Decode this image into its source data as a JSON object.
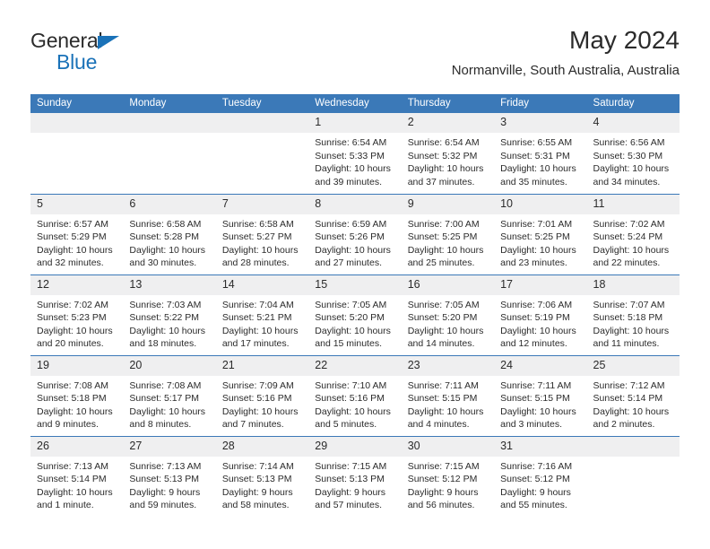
{
  "brand": {
    "name_top": "General",
    "name_bottom": "Blue",
    "accent_color": "#1a72b8"
  },
  "header": {
    "title": "May 2024",
    "subtitle": "Normanville, South Australia, Australia"
  },
  "calendar": {
    "header_bg": "#3b79b8",
    "daynum_bg": "#efeff0",
    "weekday_headers": [
      "Sunday",
      "Monday",
      "Tuesday",
      "Wednesday",
      "Thursday",
      "Friday",
      "Saturday"
    ],
    "weeks": [
      [
        {
          "day": "",
          "lines": []
        },
        {
          "day": "",
          "lines": []
        },
        {
          "day": "",
          "lines": []
        },
        {
          "day": "1",
          "lines": [
            "Sunrise: 6:54 AM",
            "Sunset: 5:33 PM",
            "Daylight: 10 hours",
            "and 39 minutes."
          ]
        },
        {
          "day": "2",
          "lines": [
            "Sunrise: 6:54 AM",
            "Sunset: 5:32 PM",
            "Daylight: 10 hours",
            "and 37 minutes."
          ]
        },
        {
          "day": "3",
          "lines": [
            "Sunrise: 6:55 AM",
            "Sunset: 5:31 PM",
            "Daylight: 10 hours",
            "and 35 minutes."
          ]
        },
        {
          "day": "4",
          "lines": [
            "Sunrise: 6:56 AM",
            "Sunset: 5:30 PM",
            "Daylight: 10 hours",
            "and 34 minutes."
          ]
        }
      ],
      [
        {
          "day": "5",
          "lines": [
            "Sunrise: 6:57 AM",
            "Sunset: 5:29 PM",
            "Daylight: 10 hours",
            "and 32 minutes."
          ]
        },
        {
          "day": "6",
          "lines": [
            "Sunrise: 6:58 AM",
            "Sunset: 5:28 PM",
            "Daylight: 10 hours",
            "and 30 minutes."
          ]
        },
        {
          "day": "7",
          "lines": [
            "Sunrise: 6:58 AM",
            "Sunset: 5:27 PM",
            "Daylight: 10 hours",
            "and 28 minutes."
          ]
        },
        {
          "day": "8",
          "lines": [
            "Sunrise: 6:59 AM",
            "Sunset: 5:26 PM",
            "Daylight: 10 hours",
            "and 27 minutes."
          ]
        },
        {
          "day": "9",
          "lines": [
            "Sunrise: 7:00 AM",
            "Sunset: 5:25 PM",
            "Daylight: 10 hours",
            "and 25 minutes."
          ]
        },
        {
          "day": "10",
          "lines": [
            "Sunrise: 7:01 AM",
            "Sunset: 5:25 PM",
            "Daylight: 10 hours",
            "and 23 minutes."
          ]
        },
        {
          "day": "11",
          "lines": [
            "Sunrise: 7:02 AM",
            "Sunset: 5:24 PM",
            "Daylight: 10 hours",
            "and 22 minutes."
          ]
        }
      ],
      [
        {
          "day": "12",
          "lines": [
            "Sunrise: 7:02 AM",
            "Sunset: 5:23 PM",
            "Daylight: 10 hours",
            "and 20 minutes."
          ]
        },
        {
          "day": "13",
          "lines": [
            "Sunrise: 7:03 AM",
            "Sunset: 5:22 PM",
            "Daylight: 10 hours",
            "and 18 minutes."
          ]
        },
        {
          "day": "14",
          "lines": [
            "Sunrise: 7:04 AM",
            "Sunset: 5:21 PM",
            "Daylight: 10 hours",
            "and 17 minutes."
          ]
        },
        {
          "day": "15",
          "lines": [
            "Sunrise: 7:05 AM",
            "Sunset: 5:20 PM",
            "Daylight: 10 hours",
            "and 15 minutes."
          ]
        },
        {
          "day": "16",
          "lines": [
            "Sunrise: 7:05 AM",
            "Sunset: 5:20 PM",
            "Daylight: 10 hours",
            "and 14 minutes."
          ]
        },
        {
          "day": "17",
          "lines": [
            "Sunrise: 7:06 AM",
            "Sunset: 5:19 PM",
            "Daylight: 10 hours",
            "and 12 minutes."
          ]
        },
        {
          "day": "18",
          "lines": [
            "Sunrise: 7:07 AM",
            "Sunset: 5:18 PM",
            "Daylight: 10 hours",
            "and 11 minutes."
          ]
        }
      ],
      [
        {
          "day": "19",
          "lines": [
            "Sunrise: 7:08 AM",
            "Sunset: 5:18 PM",
            "Daylight: 10 hours",
            "and 9 minutes."
          ]
        },
        {
          "day": "20",
          "lines": [
            "Sunrise: 7:08 AM",
            "Sunset: 5:17 PM",
            "Daylight: 10 hours",
            "and 8 minutes."
          ]
        },
        {
          "day": "21",
          "lines": [
            "Sunrise: 7:09 AM",
            "Sunset: 5:16 PM",
            "Daylight: 10 hours",
            "and 7 minutes."
          ]
        },
        {
          "day": "22",
          "lines": [
            "Sunrise: 7:10 AM",
            "Sunset: 5:16 PM",
            "Daylight: 10 hours",
            "and 5 minutes."
          ]
        },
        {
          "day": "23",
          "lines": [
            "Sunrise: 7:11 AM",
            "Sunset: 5:15 PM",
            "Daylight: 10 hours",
            "and 4 minutes."
          ]
        },
        {
          "day": "24",
          "lines": [
            "Sunrise: 7:11 AM",
            "Sunset: 5:15 PM",
            "Daylight: 10 hours",
            "and 3 minutes."
          ]
        },
        {
          "day": "25",
          "lines": [
            "Sunrise: 7:12 AM",
            "Sunset: 5:14 PM",
            "Daylight: 10 hours",
            "and 2 minutes."
          ]
        }
      ],
      [
        {
          "day": "26",
          "lines": [
            "Sunrise: 7:13 AM",
            "Sunset: 5:14 PM",
            "Daylight: 10 hours",
            "and 1 minute."
          ]
        },
        {
          "day": "27",
          "lines": [
            "Sunrise: 7:13 AM",
            "Sunset: 5:13 PM",
            "Daylight: 9 hours",
            "and 59 minutes."
          ]
        },
        {
          "day": "28",
          "lines": [
            "Sunrise: 7:14 AM",
            "Sunset: 5:13 PM",
            "Daylight: 9 hours",
            "and 58 minutes."
          ]
        },
        {
          "day": "29",
          "lines": [
            "Sunrise: 7:15 AM",
            "Sunset: 5:13 PM",
            "Daylight: 9 hours",
            "and 57 minutes."
          ]
        },
        {
          "day": "30",
          "lines": [
            "Sunrise: 7:15 AM",
            "Sunset: 5:12 PM",
            "Daylight: 9 hours",
            "and 56 minutes."
          ]
        },
        {
          "day": "31",
          "lines": [
            "Sunrise: 7:16 AM",
            "Sunset: 5:12 PM",
            "Daylight: 9 hours",
            "and 55 minutes."
          ]
        },
        {
          "day": "",
          "lines": []
        }
      ]
    ]
  }
}
